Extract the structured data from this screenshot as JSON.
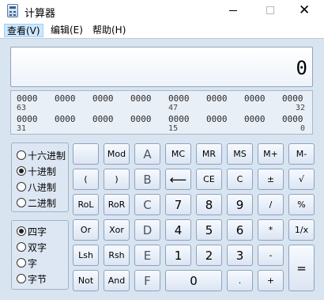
{
  "window": {
    "title": "计算器",
    "controls": {
      "minimize": "—",
      "maximize": "",
      "close": "✕"
    }
  },
  "menu": [
    "查看(V)",
    "编辑(E)",
    "帮助(H)"
  ],
  "display": {
    "value": "0"
  },
  "bits": {
    "row1_groups": [
      "0000",
      "0000",
      "0000",
      "0000",
      "0000",
      "0000",
      "0000",
      "0000"
    ],
    "row1_positions": [
      "63",
      "47",
      "32"
    ],
    "row2_groups": [
      "0000",
      "0000",
      "0000",
      "0000",
      "0000",
      "0000",
      "0000",
      "0000"
    ],
    "row2_positions": [
      "31",
      "15",
      "0"
    ]
  },
  "base_options": [
    {
      "label": "十六进制",
      "selected": false
    },
    {
      "label": "十进制",
      "selected": true
    },
    {
      "label": "八进制",
      "selected": false
    },
    {
      "label": "二进制",
      "selected": false
    }
  ],
  "word_options": [
    {
      "label": "四字",
      "selected": true
    },
    {
      "label": "双字",
      "selected": false
    },
    {
      "label": "字",
      "selected": false
    },
    {
      "label": "字节",
      "selected": false
    }
  ],
  "buttons": {
    "blank": "",
    "mod": "Mod",
    "a": "A",
    "mc": "MC",
    "mr": "MR",
    "ms": "MS",
    "mplus": "M+",
    "mminus": "M-",
    "lparen": "(",
    "rparen": ")",
    "b": "B",
    "backspace": "⟵",
    "ce": "CE",
    "c": "C",
    "plusminus": "±",
    "sqrt": "√",
    "rol": "RoL",
    "ror": "RoR",
    "hex_c": "C",
    "n7": "7",
    "n8": "8",
    "n9": "9",
    "divide": "/",
    "percent": "%",
    "or": "Or",
    "xor": "Xor",
    "d": "D",
    "n4": "4",
    "n5": "5",
    "n6": "6",
    "multiply": "*",
    "reciprocal": "1/x",
    "lsh": "Lsh",
    "rsh": "Rsh",
    "e": "E",
    "n1": "1",
    "n2": "2",
    "n3": "3",
    "minus": "-",
    "equals": "=",
    "not": "Not",
    "and": "And",
    "f": "F",
    "n0": "0",
    "dot": ".",
    "plus": "+"
  }
}
